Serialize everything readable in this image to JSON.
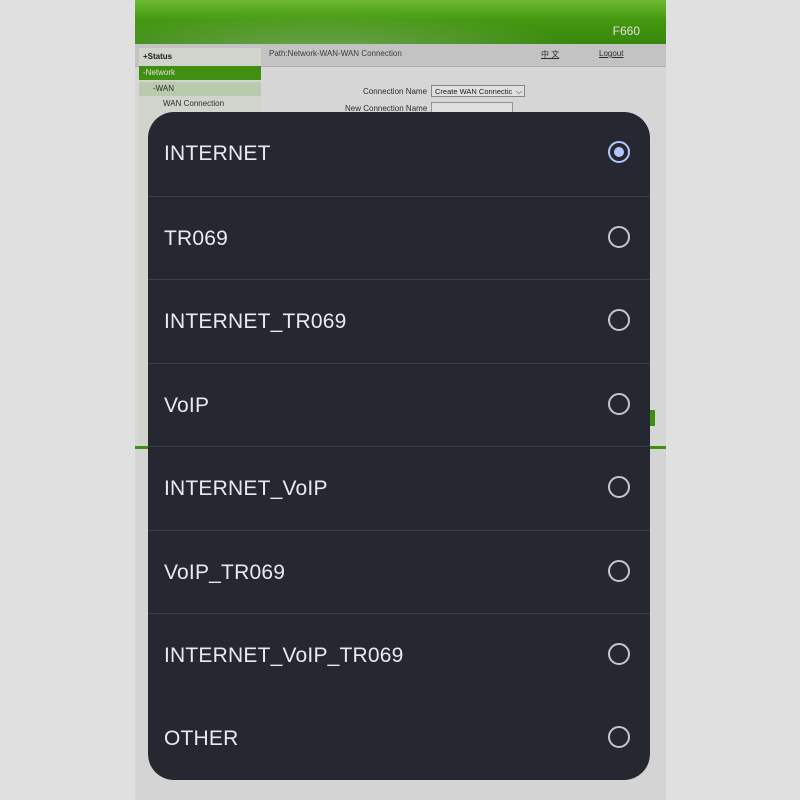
{
  "router": {
    "model": "F660",
    "breadcrumb": "Path:Network-WAN-WAN Connection",
    "language_link": "中 文",
    "logout_link": "Logout",
    "sidebar": {
      "status": "+Status",
      "network": "-Network",
      "wan": "-WAN",
      "wan_connection": "WAN Connection"
    },
    "form": {
      "connection_name_label": "Connection Name",
      "connection_name_value": "Create WAN Connectic",
      "new_connection_name_label": "New Connection Name"
    }
  },
  "dialog": {
    "options": [
      {
        "label": "INTERNET",
        "selected": true
      },
      {
        "label": "TR069",
        "selected": false
      },
      {
        "label": "INTERNET_TR069",
        "selected": false
      },
      {
        "label": "VoIP",
        "selected": false
      },
      {
        "label": "INTERNET_VoIP",
        "selected": false
      },
      {
        "label": "VoIP_TR069",
        "selected": false
      },
      {
        "label": "INTERNET_VoIP_TR069",
        "selected": false
      },
      {
        "label": "OTHER",
        "selected": false
      }
    ]
  },
  "colors": {
    "dialog_bg": "#252830",
    "radio_selected": "#b4c4ff",
    "header_green": "#4aa315"
  },
  "icons": {
    "radio_selected": "radio-checked-icon",
    "radio_unselected": "radio-unchecked-icon",
    "dropdown": "chevron-down-icon"
  }
}
